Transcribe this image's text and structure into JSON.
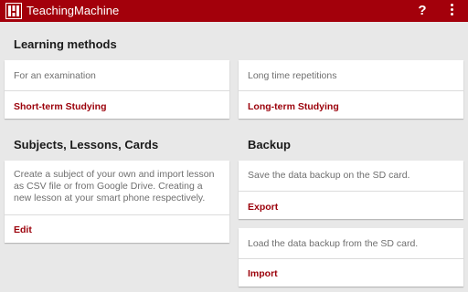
{
  "app": {
    "title": "TeachingMachine",
    "help_label": "?",
    "brand_color": "#a3000b",
    "accent_color": "#9b000a",
    "icons": {
      "logo": "teaching-machine-logo",
      "help": "question-mark-icon",
      "menu": "overflow-menu-icon"
    }
  },
  "learning_methods": {
    "title": "Learning methods",
    "cards": [
      {
        "description": "For an examination",
        "action": "Short-term Studying"
      },
      {
        "description": "Long time repetitions",
        "action": "Long-term Studying"
      }
    ]
  },
  "subjects": {
    "title": "Subjects, Lessons, Cards",
    "card": {
      "description": "Create a subject of your own and import lesson as CSV file or from Google Drive. Creating a new lesson at your smart phone respectively.",
      "action": "Edit"
    }
  },
  "backup": {
    "title": "Backup",
    "cards": [
      {
        "description": "Save the data backup on the SD card.",
        "action": "Export"
      },
      {
        "description": "Load the data backup from the SD card.",
        "action": "Import"
      }
    ]
  }
}
